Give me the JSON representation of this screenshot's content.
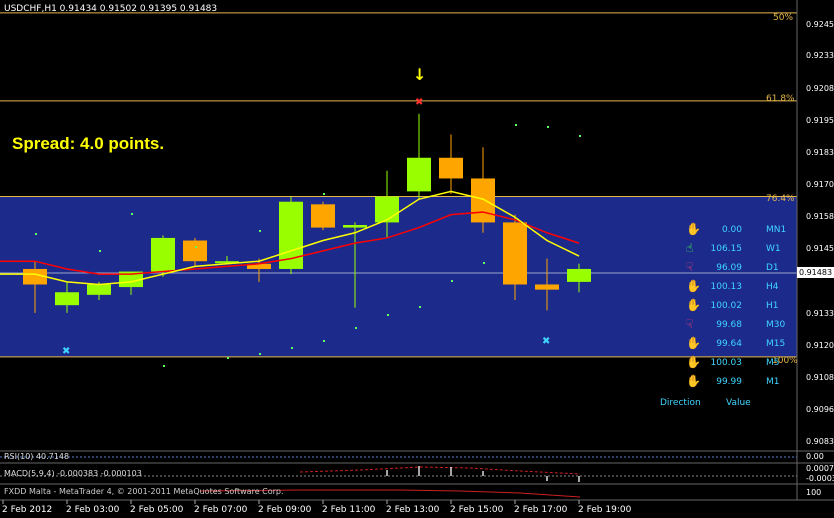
{
  "window": {
    "title": "USDCHF,H1  0.91434 0.91502 0.91395 0.91483"
  },
  "spread_label": "Spread: 4.0 points.",
  "fib_levels": [
    "50%",
    "61.8%",
    "76.4%",
    "100%"
  ],
  "current_price": "0.91483",
  "price_axis": [
    "0.92455",
    "0.92330",
    "0.92080",
    "0.91955",
    "0.91830",
    "0.91705",
    "0.91580",
    "0.91455",
    "0.91330",
    "0.91205",
    "0.91085",
    "0.90960",
    "0.90835"
  ],
  "time_axis": [
    "2 Feb 2012",
    "2 Feb 03:00",
    "2 Feb 05:00",
    "2 Feb 07:00",
    "2 Feb 09:00",
    "2 Feb 11:00",
    "2 Feb 13:00",
    "2 Feb 15:00",
    "2 Feb 17:00",
    "2 Feb 19:00"
  ],
  "indicators": {
    "rsi_label": "RSI(10) 40.7148",
    "rsi_axis": "0.00",
    "macd_label": "MACD(5,9,4) -0.000383 -0.000103",
    "macd_axis_top": "0.00075",
    "macd_axis_bottom": "-0.00034",
    "stoch_axis": "100",
    "copyright": "FXDD Malta - MetaTrader 4, © 2001-2011 MetaQuotes Software Corp."
  },
  "direction_panel": {
    "header_direction": "Direction",
    "header_value": "Value",
    "rows": [
      {
        "value": "0.00",
        "timeframe": "MN1",
        "direction": "neutral"
      },
      {
        "value": "106.15",
        "timeframe": "W1",
        "direction": "up"
      },
      {
        "value": "96.09",
        "timeframe": "D1",
        "direction": "down"
      },
      {
        "value": "100.13",
        "timeframe": "H4",
        "direction": "neutral"
      },
      {
        "value": "100.02",
        "timeframe": "H1",
        "direction": "neutral"
      },
      {
        "value": "99.68",
        "timeframe": "M30",
        "direction": "down"
      },
      {
        "value": "99.64",
        "timeframe": "M15",
        "direction": "neutral"
      },
      {
        "value": "100.03",
        "timeframe": "M5",
        "direction": "neutral"
      },
      {
        "value": "99.99",
        "timeframe": "M1",
        "direction": "neutral"
      }
    ]
  },
  "colors": {
    "bull": "#99ff00",
    "bear": "#ffa500",
    "zone": "#1c2a8c",
    "fib": "#e6b84a",
    "ma_fast": "#ffff00",
    "ma_slow": "#ff0000",
    "accent_text": "#3fd5ff"
  },
  "chart_data": {
    "type": "candlestick",
    "symbol": "USDCHF,H1",
    "ylim": [
      0.9078,
      0.9252
    ],
    "candles": [
      {
        "o": 0.9148,
        "h": 0.9151,
        "l": 0.9131,
        "c": 0.9142
      },
      {
        "o": 0.9134,
        "h": 0.9143,
        "l": 0.9131,
        "c": 0.9139
      },
      {
        "o": 0.9138,
        "h": 0.9143,
        "l": 0.9136,
        "c": 0.9142
      },
      {
        "o": 0.9141,
        "h": 0.9147,
        "l": 0.9138,
        "c": 0.9147
      },
      {
        "o": 0.9147,
        "h": 0.9161,
        "l": 0.9145,
        "c": 0.916
      },
      {
        "o": 0.9159,
        "h": 0.916,
        "l": 0.9149,
        "c": 0.9151
      },
      {
        "o": 0.9151,
        "h": 0.9153,
        "l": 0.915,
        "c": 0.9151
      },
      {
        "o": 0.915,
        "h": 0.9152,
        "l": 0.9143,
        "c": 0.9148
      },
      {
        "o": 0.9148,
        "h": 0.9176,
        "l": 0.9146,
        "c": 0.9174
      },
      {
        "o": 0.9173,
        "h": 0.9174,
        "l": 0.9163,
        "c": 0.9164
      },
      {
        "o": 0.9164,
        "h": 0.9166,
        "l": 0.9133,
        "c": 0.9165
      },
      {
        "o": 0.9166,
        "h": 0.9186,
        "l": 0.916,
        "c": 0.9176
      },
      {
        "o": 0.9178,
        "h": 0.9208,
        "l": 0.9175,
        "c": 0.9191
      },
      {
        "o": 0.9191,
        "h": 0.92,
        "l": 0.9177,
        "c": 0.9183
      },
      {
        "o": 0.9183,
        "h": 0.9195,
        "l": 0.9162,
        "c": 0.9166
      },
      {
        "o": 0.9166,
        "h": 0.9169,
        "l": 0.9136,
        "c": 0.9142
      },
      {
        "o": 0.9142,
        "h": 0.9152,
        "l": 0.9132,
        "c": 0.914
      },
      {
        "o": 0.9143,
        "h": 0.915,
        "l": 0.9139,
        "c": 0.9148
      }
    ],
    "ma_fast": [
      0.9146,
      0.9143,
      0.9142,
      0.9143,
      0.9146,
      0.9149,
      0.915,
      0.9151,
      0.9155,
      0.9159,
      0.9162,
      0.9167,
      0.9175,
      0.9178,
      0.9175,
      0.9168,
      0.9159,
      0.9153
    ],
    "ma_slow": [
      0.9151,
      0.9148,
      0.9146,
      0.9146,
      0.9147,
      0.9148,
      0.9149,
      0.915,
      0.9152,
      0.9155,
      0.9158,
      0.916,
      0.9164,
      0.9169,
      0.917,
      0.9167,
      0.9162,
      0.9158
    ],
    "fib_prices": [
      0.9247,
      0.9213,
      0.9176,
      0.9114
    ],
    "zone": [
      0.9114,
      0.9176
    ]
  }
}
